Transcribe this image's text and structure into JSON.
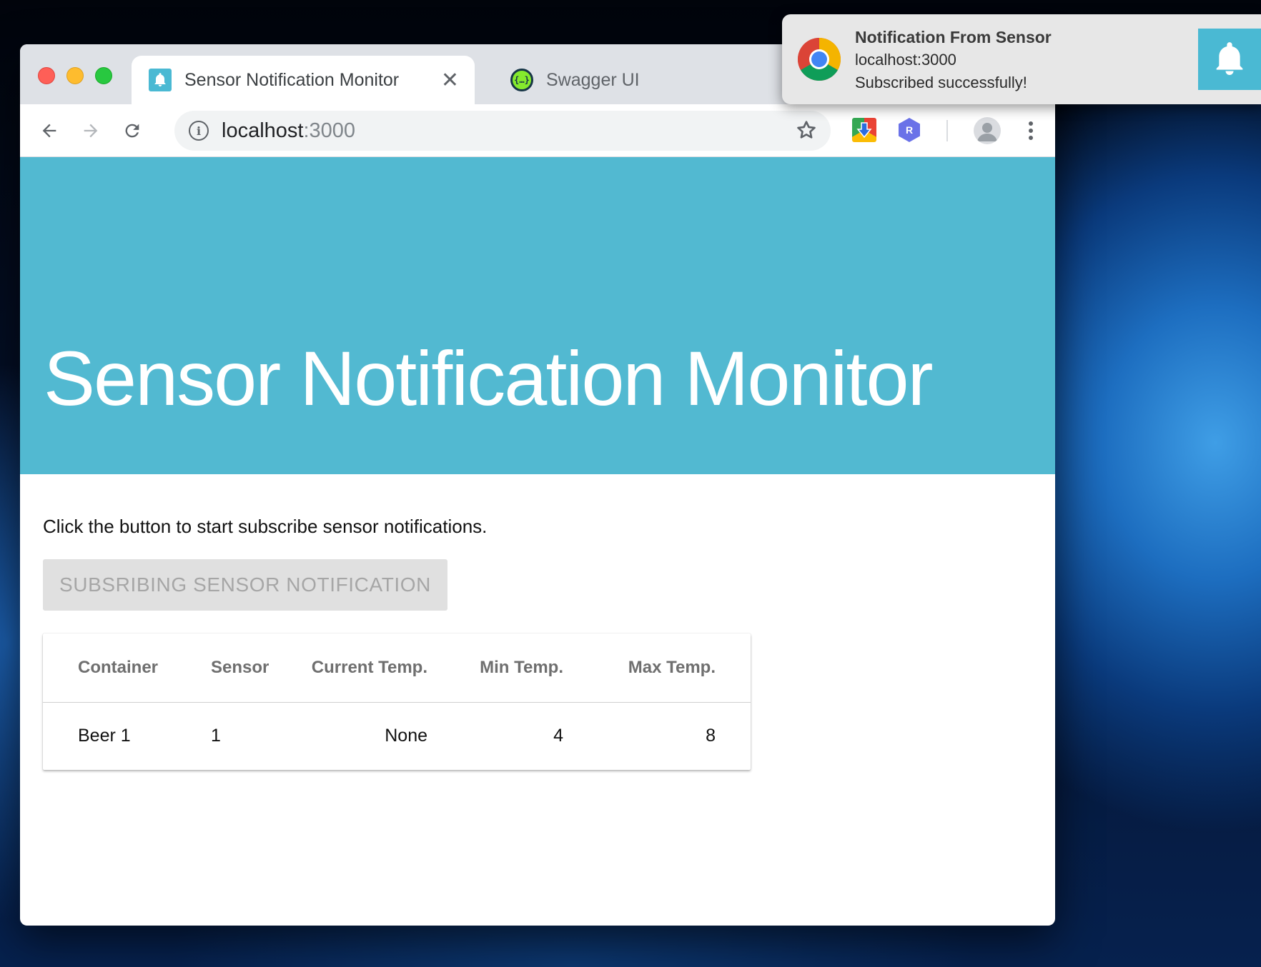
{
  "window": {
    "tabs": [
      {
        "title": "Sensor Notification Monitor",
        "favicon": "bell-icon",
        "active": true
      },
      {
        "title": "Swagger UI",
        "favicon": "swagger-icon",
        "active": false
      }
    ],
    "tab_close_glyph": "✕",
    "address": {
      "host": "localhost",
      "port": ":3000"
    },
    "extensions": [
      "chrome-download-icon",
      "r-extension-icon"
    ]
  },
  "page": {
    "hero_title": "Sensor Notification Monitor",
    "intro_text": "Click the button to start subscribe sensor notifications.",
    "subscribe_button_label": "SUBSRIBING SENSOR NOTIFICATION",
    "subscribe_button_disabled": true,
    "table": {
      "headers": [
        "Container",
        "Sensor",
        "Current Temp.",
        "Min Temp.",
        "Max Temp."
      ],
      "rows": [
        [
          "Beer 1",
          "1",
          "None",
          "4",
          "8"
        ]
      ]
    }
  },
  "notification": {
    "title": "Notification From Sensor",
    "origin": "localhost:3000",
    "message": "Subscribed successfully!",
    "app_icon": "chrome-icon",
    "badge_icon": "bell-icon"
  },
  "colors": {
    "hero": "#52b9d1",
    "accent": "#4ab9d3"
  }
}
